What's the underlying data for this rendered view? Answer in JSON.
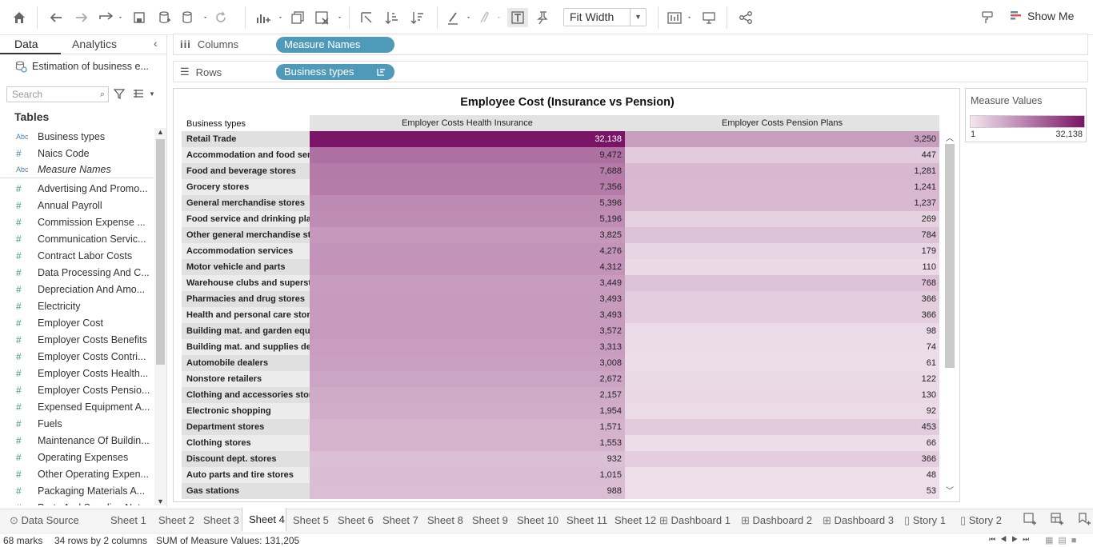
{
  "toolbar": {
    "fit_label": "Fit Width",
    "show_me_label": "Show Me"
  },
  "left_panel": {
    "tab_data": "Data",
    "tab_analytics": "Analytics",
    "datasource": "Estimation of business e...",
    "search_placeholder": "Search",
    "tables_heading": "Tables",
    "dimensions": [
      {
        "icon": "Abc",
        "label": "Business types",
        "italic": false
      },
      {
        "icon": "#",
        "label": "Naics Code",
        "italic": false
      },
      {
        "icon": "Abc",
        "label": "Measure Names",
        "italic": true
      }
    ],
    "measures": [
      "Advertising And Promo...",
      "Annual Payroll",
      "Commission Expense ...",
      "Communication Servic...",
      "Contract Labor Costs",
      "Data Processing And C...",
      "Depreciation And Amo...",
      "Electricity",
      "Employer Cost",
      "Employer Costs Benefits",
      "Employer Costs Contri...",
      "Employer Costs Health...",
      "Employer Costs Pensio...",
      "Expensed Equipment A...",
      "Fuels",
      "Maintenance Of Buildin...",
      "Operating Expenses",
      "Other Operating Expen...",
      "Packaging Materials A...",
      "Parts And Supplies Not..."
    ]
  },
  "shelves": {
    "columns_label": "Columns",
    "columns_pill": "Measure Names",
    "rows_label": "Rows",
    "rows_pill": "Business types"
  },
  "view": {
    "title": "Employee Cost (Insurance vs Pension)",
    "row_header": "Business types",
    "col1_header": "Employer Costs Health Insurance",
    "col2_header": "Employer Costs Pension Plans",
    "rows": [
      {
        "label": "Retail Trade",
        "health": "32,138",
        "health_v": 32138,
        "pension": "3,250",
        "pension_v": 3250
      },
      {
        "label": "Accommodation and food serv..",
        "health": "9,472",
        "health_v": 9472,
        "pension": "447",
        "pension_v": 447
      },
      {
        "label": "Food and beverage stores",
        "health": "7,688",
        "health_v": 7688,
        "pension": "1,281",
        "pension_v": 1281
      },
      {
        "label": "Grocery stores",
        "health": "7,356",
        "health_v": 7356,
        "pension": "1,241",
        "pension_v": 1241
      },
      {
        "label": "General merchandise stores",
        "health": "5,396",
        "health_v": 5396,
        "pension": "1,237",
        "pension_v": 1237
      },
      {
        "label": "Food service and drinking pla..",
        "health": "5,196",
        "health_v": 5196,
        "pension": "269",
        "pension_v": 269
      },
      {
        "label": "Other general merchandise st..",
        "health": "3,825",
        "health_v": 3825,
        "pension": "784",
        "pension_v": 784
      },
      {
        "label": "Accommodation services",
        "health": "4,276",
        "health_v": 4276,
        "pension": "179",
        "pension_v": 179
      },
      {
        "label": "Motor vehicle and parts",
        "health": "4,312",
        "health_v": 4312,
        "pension": "110",
        "pension_v": 110
      },
      {
        "label": "Warehouse clubs and superst..",
        "health": "3,449",
        "health_v": 3449,
        "pension": "768",
        "pension_v": 768
      },
      {
        "label": "Pharmacies and drug stores",
        "health": "3,493",
        "health_v": 3493,
        "pension": "366",
        "pension_v": 366
      },
      {
        "label": "Health and personal care stor..",
        "health": "3,493",
        "health_v": 3493,
        "pension": "366",
        "pension_v": 366
      },
      {
        "label": "Building mat. and garden equi..",
        "health": "3,572",
        "health_v": 3572,
        "pension": "98",
        "pension_v": 98
      },
      {
        "label": "Building mat. and supplies de..",
        "health": "3,313",
        "health_v": 3313,
        "pension": "74",
        "pension_v": 74
      },
      {
        "label": "Automobile dealers",
        "health": "3,008",
        "health_v": 3008,
        "pension": "61",
        "pension_v": 61
      },
      {
        "label": "Nonstore retailers",
        "health": "2,672",
        "health_v": 2672,
        "pension": "122",
        "pension_v": 122
      },
      {
        "label": "Clothing and accessories stor..",
        "health": "2,157",
        "health_v": 2157,
        "pension": "130",
        "pension_v": 130
      },
      {
        "label": "Electronic shopping",
        "health": "1,954",
        "health_v": 1954,
        "pension": "92",
        "pension_v": 92
      },
      {
        "label": "Department stores",
        "health": "1,571",
        "health_v": 1571,
        "pension": "453",
        "pension_v": 453
      },
      {
        "label": "Clothing stores",
        "health": "1,553",
        "health_v": 1553,
        "pension": "66",
        "pension_v": 66
      },
      {
        "label": "Discount dept. stores",
        "health": "932",
        "health_v": 932,
        "pension": "366",
        "pension_v": 366
      },
      {
        "label": "Auto parts and tire stores",
        "health": "1,015",
        "health_v": 1015,
        "pension": "48",
        "pension_v": 48
      },
      {
        "label": "Gas stations",
        "health": "988",
        "health_v": 988,
        "pension": "53",
        "pension_v": 53
      }
    ]
  },
  "legend": {
    "title": "Measure Values",
    "min": "1",
    "max": "32,138",
    "min_v": 1,
    "max_v": 32138,
    "color_low": "#f3e6f0",
    "color_high": "#7a1466"
  },
  "sheet_tabs": [
    {
      "label": "Data Source",
      "icon": "datasource-icon",
      "active": false
    },
    {
      "label": "Sheet 1",
      "active": false
    },
    {
      "label": "Sheet 2",
      "active": false
    },
    {
      "label": "Sheet 3",
      "active": false
    },
    {
      "label": "Sheet 4",
      "active": true
    },
    {
      "label": "Sheet 5",
      "active": false
    },
    {
      "label": "Sheet 6",
      "active": false
    },
    {
      "label": "Sheet 7",
      "active": false
    },
    {
      "label": "Sheet 8",
      "active": false
    },
    {
      "label": "Sheet 9",
      "active": false
    },
    {
      "label": "Sheet 10",
      "active": false
    },
    {
      "label": "Sheet 11",
      "active": false
    },
    {
      "label": "Sheet 12",
      "active": false
    },
    {
      "label": "Dashboard 1",
      "icon": "dashboard-icon",
      "active": false
    },
    {
      "label": "Dashboard 2",
      "icon": "dashboard-icon",
      "active": false
    },
    {
      "label": "Dashboard 3",
      "icon": "dashboard-icon",
      "active": false
    },
    {
      "label": "Story 1",
      "icon": "story-icon",
      "active": false
    },
    {
      "label": "Story 2",
      "icon": "story-icon",
      "active": false
    }
  ],
  "status": {
    "marks": "68 marks",
    "dims": "34 rows by 2 columns",
    "sum": "SUM of Measure Values: 131,205"
  }
}
